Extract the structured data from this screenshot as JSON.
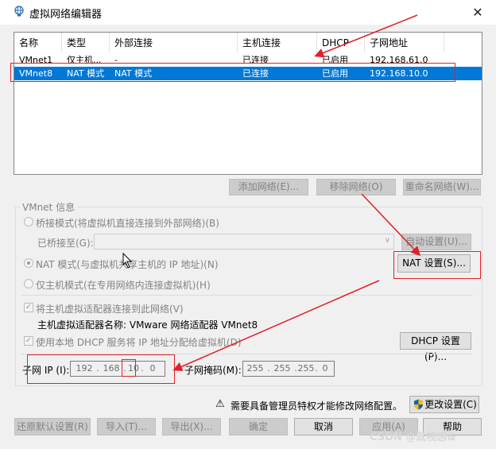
{
  "window": {
    "title": "虚拟网络编辑器",
    "close_glyph": "✕"
  },
  "list": {
    "columns": [
      "名称",
      "类型",
      "外部连接",
      "主机连接",
      "DHCP",
      "子网地址"
    ],
    "rows": [
      {
        "name": "VMnet1",
        "type": "仅主机...",
        "external": "-",
        "host": "已连接",
        "dhcp": "已启用",
        "subnet": "192.168.61.0",
        "selected": false
      },
      {
        "name": "VMnet8",
        "type": "NAT 模式",
        "external": "NAT 模式",
        "host": "已连接",
        "dhcp": "已启用",
        "subnet": "192.168.10.0",
        "selected": true
      }
    ]
  },
  "list_buttons": {
    "add": "添加网络(E)...",
    "remove": "移除网络(O)",
    "rename": "重命名网络(W)..."
  },
  "vmnet_info": {
    "label": "VMnet 信息",
    "bridge_mode": "桥接模式(将虚拟机直接连接到外部网络)(B)",
    "bridged_to": "已桥接至(G):",
    "auto_settings": "自动设置(U)...",
    "nat_mode": "NAT 模式(与虚拟机共享主机的 IP 地址)(N)",
    "nat_settings": "NAT 设置(S)...",
    "host_only": "仅主机模式(在专用网络内连接虚拟机)(H)",
    "connect_adapter": "将主机虚拟适配器连接到此网络(V)",
    "adapter_name": "主机虚拟适配器名称: VMware 网络适配器 VMnet8",
    "use_dhcp": "使用本地 DHCP 服务将 IP 地址分配给虚拟机(D)",
    "dhcp_settings": "DHCP 设置(P)...",
    "subnet_ip_label": "子网 IP (I):",
    "subnet_ip": [
      "192",
      "168",
      "10",
      "0"
    ],
    "subnet_mask_label": "子网掩码(M):",
    "subnet_mask": [
      "255",
      "255",
      "255",
      "0"
    ],
    "dot": "."
  },
  "admin_notice": {
    "warning_glyph": "⚠",
    "text": "需要具备管理员特权才能修改网络配置。",
    "change_settings": "更改设置(C)"
  },
  "footer": {
    "restore": "还原默认设置(R)",
    "import": "导入(T)...",
    "export": "导出(X)...",
    "ok": "确定",
    "cancel": "取消",
    "apply": "应用(A)",
    "help": "帮助"
  },
  "watermark": "CSDN @既视感&",
  "colors": {
    "selection": "#0078d7",
    "annotation_red": "#e0202a",
    "shield_blue": "#1a5fb4",
    "shield_yellow": "#f2c200"
  }
}
